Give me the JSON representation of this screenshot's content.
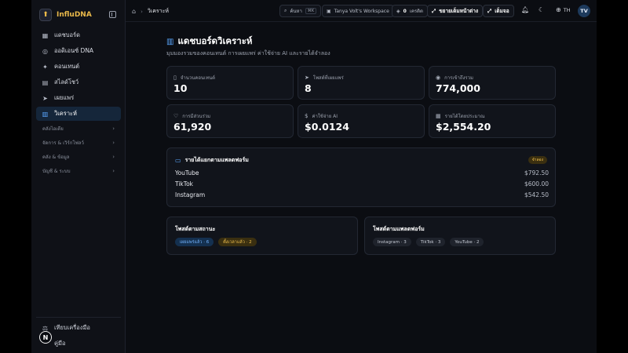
{
  "brand": {
    "name": "InfluDNA"
  },
  "sidebar": {
    "items": [
      {
        "label": "แดชบอร์ด",
        "icon": "grid-icon"
      },
      {
        "label": "ออดิเอนซ์ DNA",
        "icon": "dna-icon"
      },
      {
        "label": "คอนเทนต์",
        "icon": "sparkle-icon"
      },
      {
        "label": "สไลด์โชว์",
        "icon": "slides-icon"
      },
      {
        "label": "เผยแพร่",
        "icon": "send-icon"
      },
      {
        "label": "วิเคราะห์",
        "icon": "chart-icon",
        "active": true
      }
    ],
    "groups": [
      {
        "label": "คลังไอเดีย"
      },
      {
        "label": "จัดการ & เวิร์กโฟลว์"
      },
      {
        "label": "คลัง & ข้อมูล"
      },
      {
        "label": "บัญชี & ระบบ"
      }
    ],
    "bottom": [
      {
        "label": "เทียบเครื่องมือ",
        "icon": "scale-icon"
      },
      {
        "label": "คู่มือ",
        "icon": "book-icon"
      }
    ],
    "badge": "N"
  },
  "topbar": {
    "breadcrumb": "วิเคราะห์",
    "search_label": "ค้นหา",
    "search_kbd": "⌘K",
    "workspace": "Tanya Volt's Workspace",
    "credits_count": "0",
    "credits_label": "เครดิต",
    "expand_label": "ขยายเต็มหน้าต่าง",
    "fullscreen_label": "เต็มจอ",
    "lang": "TH",
    "avatar": "TV"
  },
  "page": {
    "title": "แดชบอร์ดวิเคราะห์",
    "subtitle": "มุมมองรวมของคอนเทนต์ การเผยแพร่ ค่าใช้จ่าย AI และรายได้จำลอง"
  },
  "stats": [
    {
      "label": "จำนวนคอนเทนต์",
      "value": "10",
      "icon": "document-icon"
    },
    {
      "label": "โพสต์ที่เผยแพร่",
      "value": "8",
      "icon": "send-icon"
    },
    {
      "label": "การเข้าถึงรวม",
      "value": "774,000",
      "icon": "eye-icon"
    },
    {
      "label": "การมีส่วนร่วม",
      "value": "61,920",
      "icon": "heart-icon"
    },
    {
      "label": "ค่าใช้จ่าย AI",
      "value": "$0.0124",
      "icon": "dollar-icon"
    },
    {
      "label": "รายได้โดยประมาณ",
      "value": "$2,554.20",
      "icon": "calendar-icon"
    }
  ],
  "revenue": {
    "title": "รายได้แยกตามแพลตฟอร์ม",
    "badge": "จำลอง",
    "rows": [
      {
        "platform": "YouTube",
        "amount": "$792.50"
      },
      {
        "platform": "TikTok",
        "amount": "$600.00"
      },
      {
        "platform": "Instagram",
        "amount": "$542.50"
      }
    ]
  },
  "by_status": {
    "title": "โพสต์ตามสถานะ",
    "chips": [
      {
        "label": "เผยแพร่แล้ว · 6"
      },
      {
        "label": "ตั้งเวลาแล้ว · 2"
      }
    ]
  },
  "by_platform": {
    "title": "โพสต์ตามแพลตฟอร์ม",
    "chips": [
      {
        "label": "Instagram · 3"
      },
      {
        "label": "TikTok · 3"
      },
      {
        "label": "YouTube · 2"
      }
    ]
  },
  "colors": {
    "accent": "#5aa7ff",
    "brand": "#e8b84a",
    "gold": "#f2c14e"
  }
}
